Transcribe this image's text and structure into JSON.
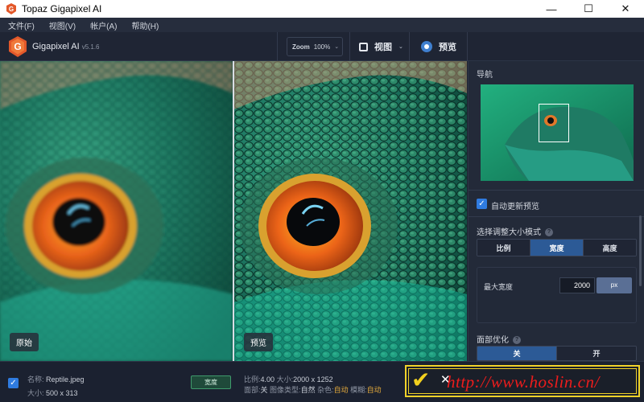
{
  "window": {
    "title": "Topaz Gigapixel AI",
    "minimize": "—",
    "maximize": "☐",
    "close": "✕"
  },
  "menu": [
    {
      "label": "文件(F)"
    },
    {
      "label": "视图(V)"
    },
    {
      "label": "帐户(A)"
    },
    {
      "label": "帮助(H)"
    }
  ],
  "toolbar": {
    "app_name": "Gigapixel AI",
    "version": "v5.1.6",
    "zoom_label": "Zoom",
    "zoom_value": "100%",
    "view_label": "视图",
    "preview_label": "预览"
  },
  "panes": {
    "left_label": "原始",
    "right_label": "预览"
  },
  "panel": {
    "nav_title": "导航",
    "auto_update_label": "自动更新预览",
    "auto_update_checked": true,
    "resize_mode_title": "选择调整大小模式",
    "resize_modes": [
      "比例",
      "宽度",
      "高度"
    ],
    "resize_mode_active": "宽度",
    "max_width_label": "最大宽度",
    "max_width_value": "2000",
    "max_width_unit": "px",
    "face_title": "面部优化",
    "face_options": [
      "关",
      "开"
    ],
    "face_active": "关"
  },
  "bottom": {
    "selected": true,
    "name_label": "名称:",
    "name_value": "Reptile.jpeg",
    "size_label": "大小:",
    "size_value": "500 x 313",
    "mode_badge": "宽度",
    "scale_label": "比例:",
    "scale_value": "4.00",
    "out_size_label": "大小:",
    "out_size_value": "2000 x 1252",
    "face_label": "面部:",
    "face_value": "关",
    "imgtype_label": "图像类型:",
    "imgtype_value": "自然",
    "noise_label": "杂色:",
    "noise_value": "自动",
    "blur_label": "模糊:",
    "blur_value": "自动",
    "cancel_label": "✕",
    "watermark": "http://www.hoslin.cn/"
  },
  "colors": {
    "accent": "#2f7be0",
    "active_segment": "#2c5a96",
    "highlight_border": "#f0d22a",
    "watermark": "#ee1c1c"
  }
}
